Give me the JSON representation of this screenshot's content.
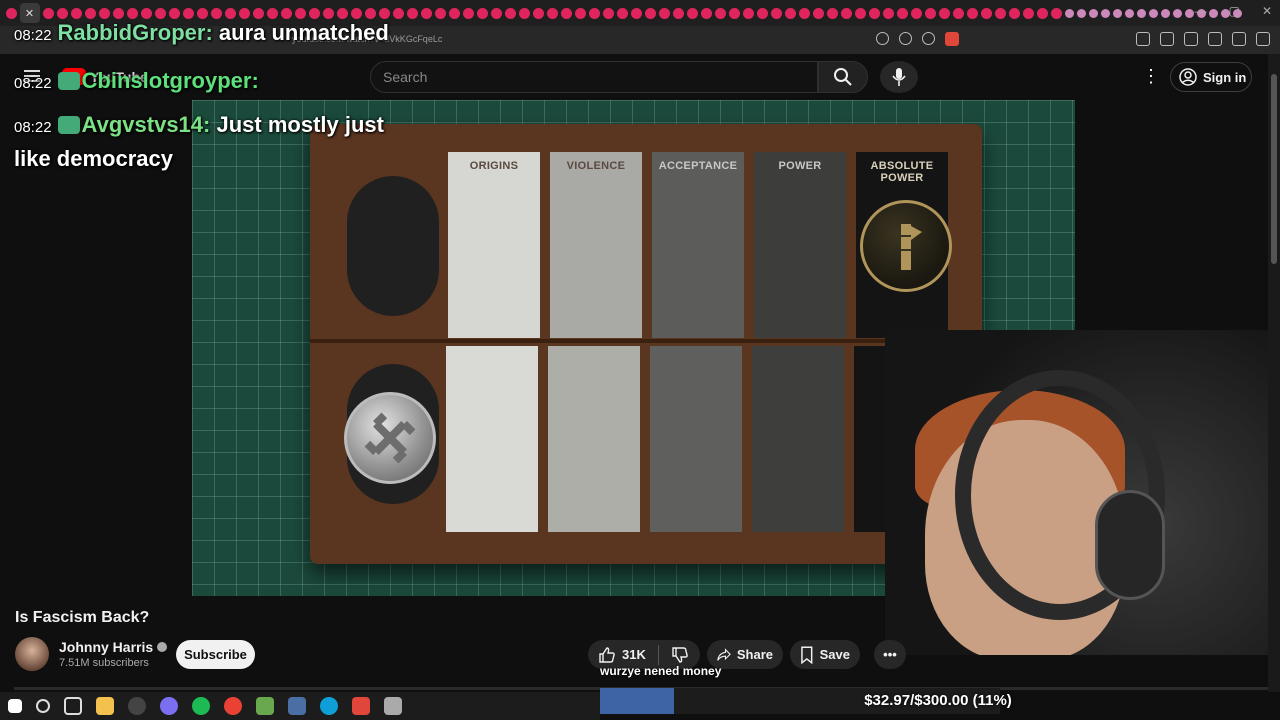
{
  "browser": {
    "url": "youtube.com/watch?v=dVkKGcFqeLc",
    "tab_close": "✕"
  },
  "header": {
    "logo_text": "YouTube",
    "search_placeholder": "Search",
    "signin_label": "Sign in"
  },
  "chat": [
    {
      "time": "08:22",
      "user": "RabbidGroper:",
      "message": "aura unmatched"
    },
    {
      "time": "08:22",
      "user": "Cbinslotgroyper:",
      "message": ""
    },
    {
      "time": "08:22",
      "user": "Avgvstvs14:",
      "message": "Just mostly just",
      "message2": "like democracy"
    }
  ],
  "video_board": {
    "columns": [
      "ORIGINS",
      "VIOLENCE",
      "ACCEPTANCE",
      "POWER",
      "ABSOLUTE POWER"
    ]
  },
  "video": {
    "title": "Is Fascism Back?",
    "channel": "Johnny Harris",
    "subscribers": "7.51M subscribers",
    "subscribe_label": "Subscribe",
    "likes": "31K",
    "share_label": "Share",
    "save_label": "Save",
    "more_label": "•••"
  },
  "stream_overlay": {
    "donor_message": "wurzye nened money",
    "goal_text": "$32.97/$300.00 (11%)",
    "goal_fraction": 0.11
  },
  "colors": {
    "tab_accent": "#e0245e",
    "subscribe_bg": "#f1f1f1",
    "goal_fill": "#3e64a6"
  }
}
